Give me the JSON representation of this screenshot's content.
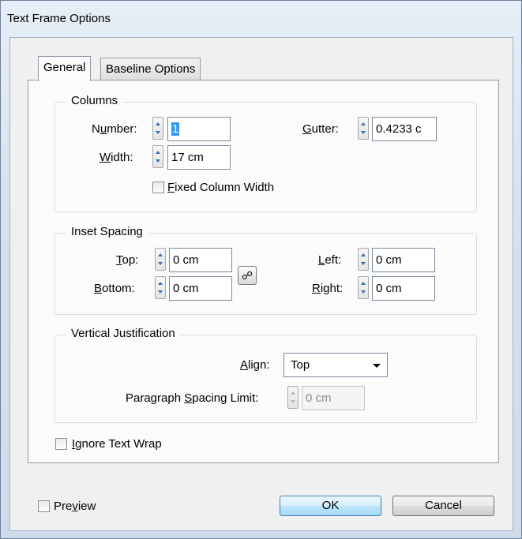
{
  "window": {
    "title": "Text Frame Options"
  },
  "tabs": [
    {
      "label": "General"
    },
    {
      "label": "Baseline Options"
    }
  ],
  "columns": {
    "legend": "Columns",
    "number_label": "Number:",
    "number_value": "1",
    "width_label": "Width:",
    "width_value": "17 cm",
    "gutter_label": "Gutter:",
    "gutter_value": "0.4233 c",
    "fixed_width_label": "Fixed Column Width",
    "fixed_width_checked": false
  },
  "inset": {
    "legend": "Inset Spacing",
    "top_label": "Top:",
    "top_value": "0 cm",
    "bottom_label": "Bottom:",
    "bottom_value": "0 cm",
    "left_label": "Left:",
    "left_value": "0 cm",
    "right_label": "Right:",
    "right_value": "0 cm",
    "link_icon": "chain-link-icon"
  },
  "vertical": {
    "legend": "Vertical Justification",
    "align_label": "Align:",
    "align_value": "Top",
    "para_limit_label": "Paragraph Spacing Limit:",
    "para_limit_value": "0 cm"
  },
  "ignore_wrap": {
    "label": "Ignore Text Wrap",
    "checked": false
  },
  "footer": {
    "preview_label": "Preview",
    "preview_checked": false,
    "ok_label": "OK",
    "cancel_label": "Cancel"
  },
  "colors": {
    "selection": "#3399ff",
    "spinner_arrow": "#3d6ea8",
    "default_button": "#bee6fd"
  }
}
